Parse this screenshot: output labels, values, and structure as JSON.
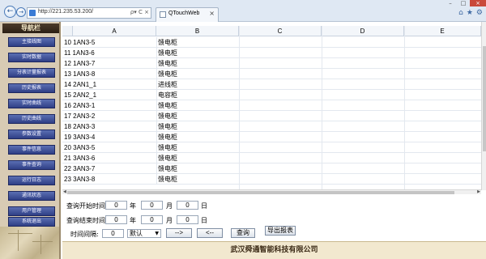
{
  "browser": {
    "url": "http://221.235.53.200/",
    "tab_title": "QTouchWeb",
    "addr_icons": "ρ▾ C ×",
    "tab_close": "×",
    "winctl": {
      "min": "–",
      "max": "□",
      "close": "×"
    },
    "tool_icons": {
      "home": "⌂",
      "star": "★",
      "gear": "⚙"
    }
  },
  "sidebar": {
    "title": "导航栏",
    "items": [
      {
        "label": "主接线图"
      },
      {
        "label": "实时数据"
      },
      {
        "label": "分表计量报表"
      },
      {
        "label": "历史报表"
      },
      {
        "label": "实时曲线"
      },
      {
        "label": "历史曲线"
      },
      {
        "label": "参数设置"
      },
      {
        "label": "事件信息"
      },
      {
        "label": "事件查询"
      },
      {
        "label": "运行日志"
      },
      {
        "label": "通讯状态"
      },
      {
        "label": "用户管理"
      },
      {
        "label": "系统退出"
      }
    ]
  },
  "grid": {
    "columns": [
      "A",
      "B",
      "C",
      "D",
      "E"
    ],
    "rows": [
      {
        "num": "10",
        "a": "1AN3-5",
        "b": "馈电柜"
      },
      {
        "num": "11",
        "a": "1AN3-6",
        "b": "馈电柜"
      },
      {
        "num": "12",
        "a": "1AN3-7",
        "b": "馈电柜"
      },
      {
        "num": "13",
        "a": "1AN3-8",
        "b": "馈电柜"
      },
      {
        "num": "14",
        "a": "2AN1_1",
        "b": "进线柜"
      },
      {
        "num": "15",
        "a": "2AN2_1",
        "b": "电容柜"
      },
      {
        "num": "16",
        "a": "2AN3-1",
        "b": "馈电柜"
      },
      {
        "num": "17",
        "a": "2AN3-2",
        "b": "馈电柜"
      },
      {
        "num": "18",
        "a": "2AN3-3",
        "b": "馈电柜"
      },
      {
        "num": "19",
        "a": "3AN3-4",
        "b": "馈电柜"
      },
      {
        "num": "20",
        "a": "3AN3-5",
        "b": "馈电柜"
      },
      {
        "num": "21",
        "a": "3AN3-6",
        "b": "馈电柜"
      },
      {
        "num": "22",
        "a": "3AN3-7",
        "b": "馈电柜"
      },
      {
        "num": "23",
        "a": "3AN3-8",
        "b": "馈电柜"
      }
    ]
  },
  "query": {
    "start_label": "查询开始时间:",
    "end_label": "查询结束时间:",
    "year": "年",
    "month": "月",
    "day": "日",
    "start": {
      "year": "0",
      "month": "0",
      "day": "0"
    },
    "end": {
      "year": "0",
      "month": "0",
      "day": "0"
    },
    "interval_label": "时间间隔:",
    "interval_value": "0",
    "interval_select": "默认",
    "next_button": "-->",
    "prev_button": "<--",
    "query_button": "查询",
    "export_button": "导出报表"
  },
  "footer": {
    "company": "武汉舜通智能科技有限公司"
  },
  "colors": {
    "sidebar_bg": "#d8cbb4",
    "nav_button": "#3a4b95",
    "footer_bg": "#f2e8cf"
  }
}
